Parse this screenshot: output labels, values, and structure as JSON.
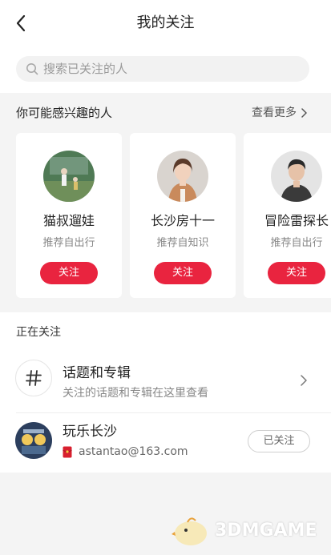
{
  "header": {
    "title": "我的关注",
    "back_icon": "chevron-left-icon"
  },
  "search": {
    "placeholder": "搜索已关注的人",
    "icon": "search-icon"
  },
  "recommend": {
    "title": "你可能感兴趣的人",
    "more_label": "查看更多",
    "cards": [
      {
        "name": "猫叔遛娃",
        "source": "推荐自出行",
        "follow_label": "关注"
      },
      {
        "name": "长沙房十一",
        "source": "推荐自知识",
        "follow_label": "关注"
      },
      {
        "name": "冒险雷探长",
        "source": "推荐自出行",
        "follow_label": "关注"
      }
    ]
  },
  "following": {
    "section_title": "正在关注",
    "topic": {
      "title": "话题和专辑",
      "subtitle": "关注的话题和专辑在这里查看",
      "icon": "hash-icon"
    },
    "user": {
      "name": "玩乐长沙",
      "email": "astantao@163.com",
      "status_label": "已关注",
      "badge_icon": "red-envelope-icon"
    }
  },
  "watermark": {
    "text": "3DMGAME"
  },
  "colors": {
    "accent": "#e9243f",
    "background": "#f4f4f4"
  }
}
